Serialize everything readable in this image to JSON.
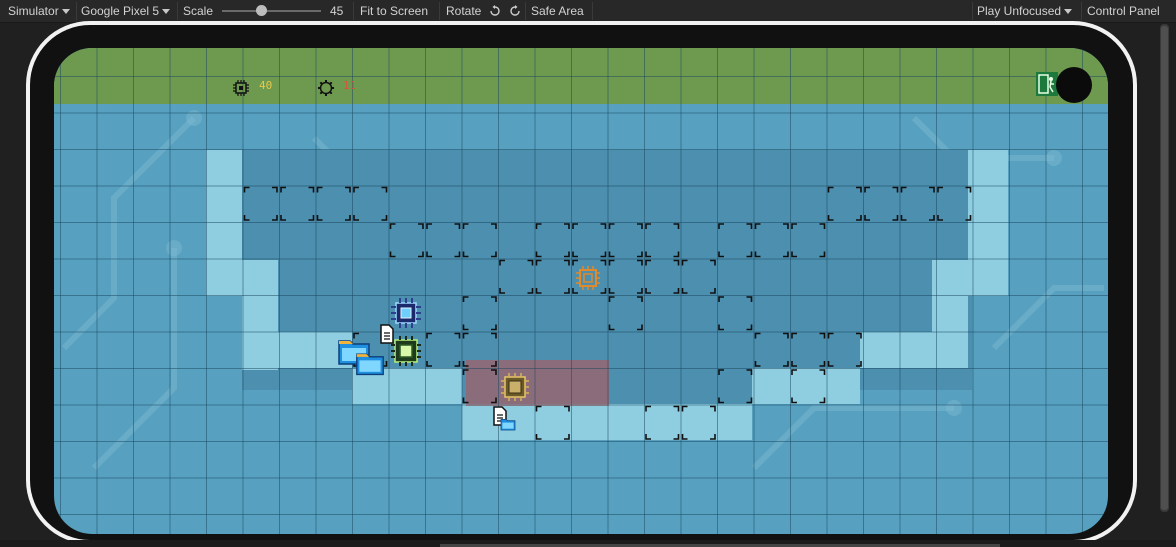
{
  "toolbar": {
    "simulator": "Simulator",
    "device": "Google Pixel 5",
    "scale_label": "Scale",
    "scale_value": "45",
    "scale_fraction": 0.35,
    "fit_to_screen": "Fit to Screen",
    "rotate": "Rotate",
    "safe_area": "Safe Area",
    "play_mode": "Play Unfocused",
    "control_panel": "Control Panel"
  },
  "hud": {
    "chip_count": "40",
    "chip_count_color": "#e6c84a",
    "gear_count": "11",
    "gear_count_color": "#d8553a",
    "chip_icon": "cpu-chip-icon",
    "gear_icon": "gear-icon",
    "exit_icon": "exit-door-icon"
  },
  "colors": {
    "screen_bg": "#57a0bf",
    "hud_bar": "#6e9a50",
    "path": "#8fcde0",
    "build_slot_marker": "#101010",
    "red_zone": "#be5050"
  },
  "game": {
    "tower_icons": [
      "blue-cpu-tower-icon",
      "green-chip-tower-icon",
      "gold-chip-tower-icon",
      "orange-chip-placement-icon"
    ],
    "enemy_icons": [
      "folder-enemy-icon",
      "document-enemy-icon"
    ]
  }
}
